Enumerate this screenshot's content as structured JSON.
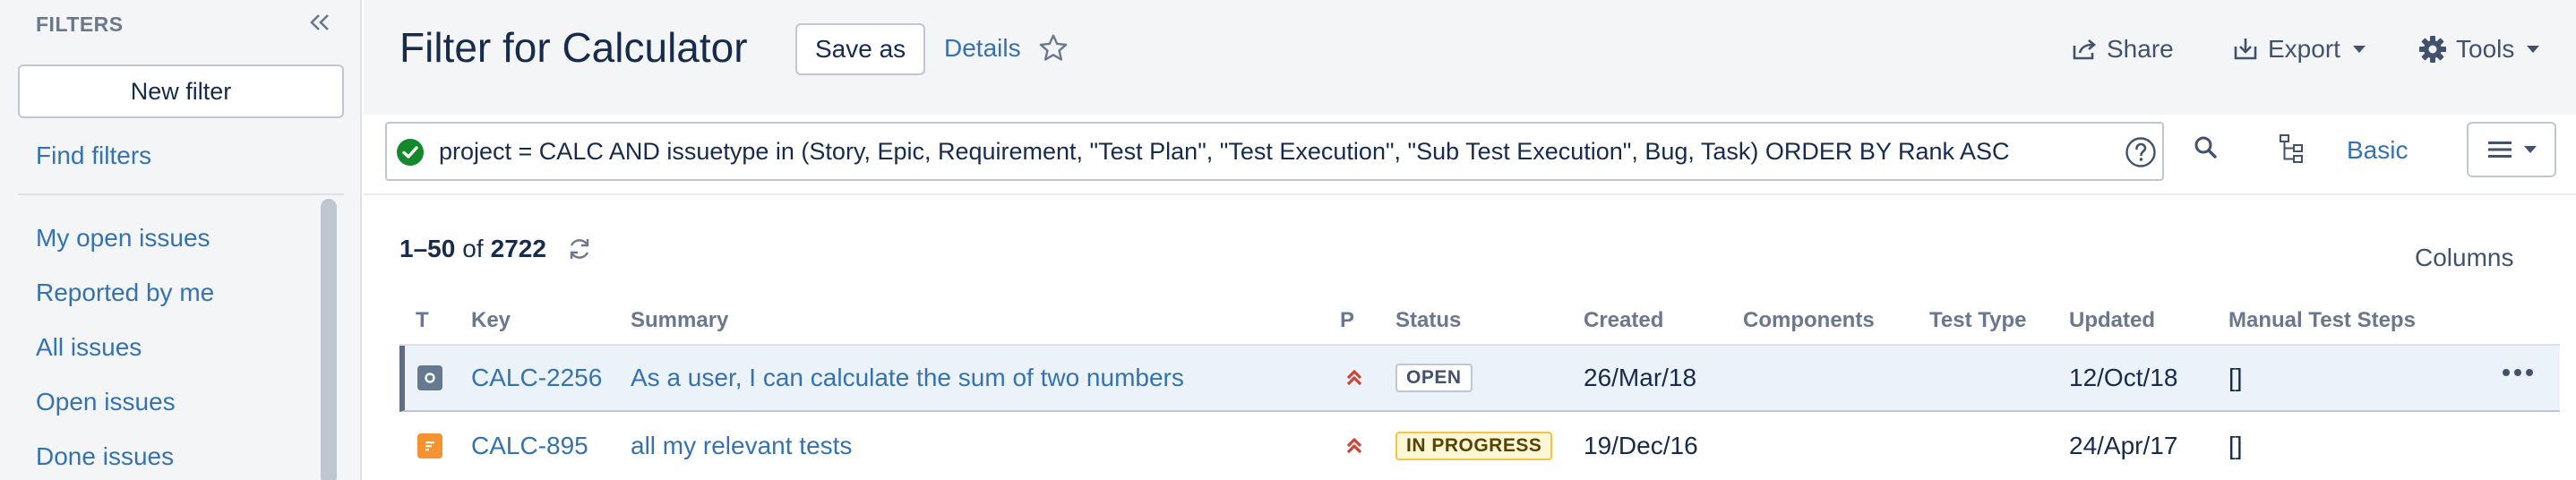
{
  "sidebar": {
    "heading": "FILTERS",
    "new_filter_label": "New filter",
    "find_filters_label": "Find filters",
    "items": [
      {
        "label": "My open issues"
      },
      {
        "label": "Reported by me"
      },
      {
        "label": "All issues"
      },
      {
        "label": "Open issues"
      },
      {
        "label": "Done issues"
      }
    ]
  },
  "header": {
    "title": "Filter for Calculator",
    "save_as_label": "Save as",
    "details_label": "Details",
    "share_label": "Share",
    "export_label": "Export",
    "tools_label": "Tools"
  },
  "search": {
    "query": "project = CALC AND issuetype in (Story, Epic, Requirement, \"Test Plan\", \"Test Execution\", \"Sub Test Execution\", Bug, Task) ORDER BY Rank ASC",
    "basic_label": "Basic"
  },
  "results": {
    "range": "1–50",
    "of_label": "of",
    "total": "2722",
    "columns_label": "Columns",
    "headers": {
      "type": "T",
      "key": "Key",
      "summary": "Summary",
      "priority": "P",
      "status": "Status",
      "created": "Created",
      "components": "Components",
      "test_type": "Test Type",
      "updated": "Updated",
      "manual_steps": "Manual Test Steps"
    },
    "rows": [
      {
        "type_icon": "story-icon",
        "key": "CALC-2256",
        "summary": "As a user, I can calculate the sum of two numbers",
        "priority_icon": "highest-priority-icon",
        "status": "OPEN",
        "created": "26/Mar/18",
        "components": "",
        "test_type": "",
        "updated": "12/Oct/18",
        "manual_steps": "[]"
      },
      {
        "type_icon": "test-plan-icon",
        "key": "CALC-895",
        "summary": "all my relevant tests",
        "priority_icon": "highest-priority-icon",
        "status": "IN PROGRESS",
        "created": "19/Dec/16",
        "components": "",
        "test_type": "",
        "updated": "24/Apr/17",
        "manual_steps": "[]"
      }
    ]
  },
  "colors": {
    "link": "#3572b0",
    "sidebar_bg": "#f4f5f7",
    "selected_row_bg": "#ebf2f9",
    "priority_red": "#d04437",
    "valid_green": "#14892c",
    "test_plan_orange": "#f79232"
  }
}
